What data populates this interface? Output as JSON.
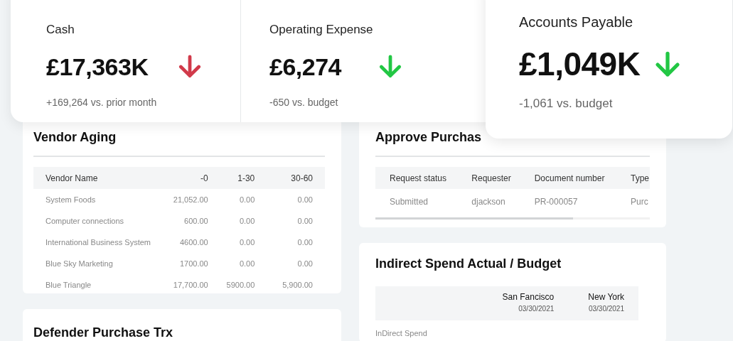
{
  "kpis": [
    {
      "label": "Cash",
      "value": "£17,363K",
      "falling": true,
      "color": "#d13a4a",
      "note": "+169,264 vs. prior month"
    },
    {
      "label": "Operating Expense",
      "value": "£6,274",
      "falling": true,
      "color": "#22c744",
      "note": "-650 vs. budget"
    }
  ],
  "featured_kpi": {
    "label": "Accounts Payable",
    "value": "£1,049K",
    "falling": true,
    "color": "#22c744",
    "note": "-1,061 vs. budget"
  },
  "vendor_aging": {
    "title": "Vendor Aging",
    "columns": [
      "Vendor Name",
      "-0",
      "1-30",
      "30-60"
    ],
    "rows": [
      [
        "System Foods",
        "21,052.00",
        "0.00",
        "0.00"
      ],
      [
        "Computer connections",
        "600.00",
        "0.00",
        "0.00"
      ],
      [
        "International Business System",
        "4600.00",
        "0.00",
        "0.00"
      ],
      [
        "Blue Sky Marketing",
        "1700.00",
        "0.00",
        "0.00"
      ],
      [
        "Blue Triangle",
        "17,700.00",
        "5900.00",
        "5,900.00"
      ]
    ]
  },
  "defender": {
    "title": "Defender Purchase Trx"
  },
  "approve": {
    "title": "Approve Purchas",
    "columns": [
      "Request status",
      "Requester",
      "Document number",
      "Type"
    ],
    "rows": [
      [
        "Submitted",
        "djackson",
        "PR-000057",
        "Purc"
      ]
    ]
  },
  "indirect": {
    "title": "Indirect Spend Actual / Budget",
    "columns": [
      {
        "name": "San Fancisco",
        "date": "03/30/2021"
      },
      {
        "name": "New York",
        "date": "03/30/2021"
      }
    ],
    "rows": [
      {
        "label": "InDirect Spend"
      }
    ]
  }
}
